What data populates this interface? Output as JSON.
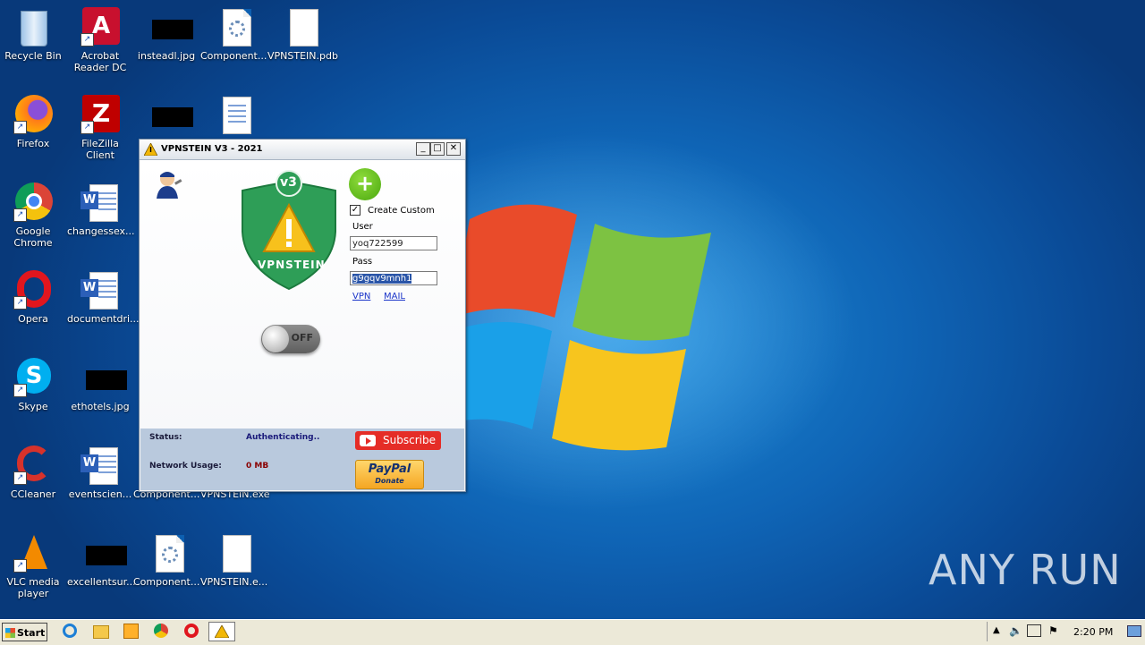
{
  "desktop": {
    "icons": [
      {
        "label": "Recycle Bin"
      },
      {
        "label": "Acrobat Reader DC"
      },
      {
        "label": "insteadl.jpg"
      },
      {
        "label": "Component..."
      },
      {
        "label": "VPNSTEIN.pdb"
      },
      {
        "label": "Firefox"
      },
      {
        "label": "FileZilla Client"
      },
      {
        "label": "Google Chrome"
      },
      {
        "label": "changessex..."
      },
      {
        "label": "Opera"
      },
      {
        "label": "documentdri..."
      },
      {
        "label": "Skype"
      },
      {
        "label": "ethotels.jpg"
      },
      {
        "label": "CCleaner"
      },
      {
        "label": "eventscien..."
      },
      {
        "label": "Component..."
      },
      {
        "label": "VPNSTEIN.exe"
      },
      {
        "label": "VLC media player"
      },
      {
        "label": "excellentsur..."
      },
      {
        "label": "Component..."
      },
      {
        "label": "VPNSTEIN.e..."
      }
    ]
  },
  "window": {
    "title": "VPNSTEIN V3 - 2021",
    "buttons": {
      "minimize": "_",
      "maximize": "□",
      "close": "✕"
    },
    "logo": {
      "badge": "v3",
      "text": "VPNSTEIN"
    },
    "toggle_label": "OFF",
    "add_symbol": "+",
    "create_custom": "Create Custom",
    "create_custom_checked": true,
    "user_label": "User",
    "user_value": "yoq722599",
    "pass_label": "Pass",
    "pass_value": "g9gqv9mnh1",
    "link_vpn": "VPN",
    "link_mail": "MAIL",
    "status_label": "Status:",
    "status_value": "Authenticating..",
    "network_label": "Network Usage:",
    "network_value": "0 MB",
    "subscribe": "Subscribe",
    "paypal": "PayPal",
    "donate": "Donate"
  },
  "taskbar": {
    "start": "Start",
    "clock": "2:20 PM"
  },
  "watermark": "ANY RUN",
  "colors": {
    "accent": "#0f64b5",
    "status_value": "#1a1a7a",
    "network_value": "#8a0000",
    "youtube": "#e52d27"
  }
}
